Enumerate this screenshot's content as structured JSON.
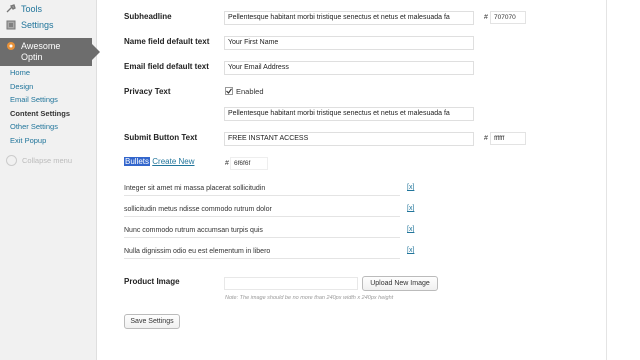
{
  "sidebar": {
    "tools_label": "Tools",
    "settings_label": "Settings",
    "active_label": "Awesome Optin",
    "submenu": [
      "Home",
      "Design",
      "Email Settings",
      "Content Settings",
      "Other Settings",
      "Exit Popup"
    ],
    "current_index": 3,
    "collapse_label": "Collapse menu"
  },
  "form": {
    "subheadline": {
      "label": "Subheadline",
      "value": "Pellentesque habitant morbi tristique senectus et netus et malesuada fa",
      "color_hash": "#",
      "color_value": "707070"
    },
    "name_field": {
      "label": "Name field default text",
      "value": "Your First Name"
    },
    "email_field": {
      "label": "Email field default text",
      "value": "Your Email Address"
    },
    "privacy": {
      "label": "Privacy Text",
      "enabled_label": "Enabled",
      "checked": true,
      "value": "Pellentesque habitant morbi tristique senectus et netus et malesuada fa"
    },
    "submit": {
      "label": "Submit Button Text",
      "value": "FREE INSTANT ACCESS",
      "color_hash": "#",
      "color_value": "ffffff"
    },
    "bullets": {
      "label": "Bullets",
      "create_new": "Create New",
      "color_hash": "#",
      "color_value": "6f6f6f",
      "remove_label": "[x]",
      "items": [
        "Integer sit amet mi massa placerat sollicitudin",
        "sollicitudin metus ndisse commodo rutrum dolor",
        "Nunc commodo rutrum accumsan turpis quis",
        "Nulla dignissim odio eu est elementum in libero"
      ]
    },
    "product_image": {
      "label": "Product Image",
      "upload_button": "Upload New Image",
      "note": "Note: The image should be no more than 240px width x 240px height"
    },
    "save_button": "Save Settings"
  }
}
